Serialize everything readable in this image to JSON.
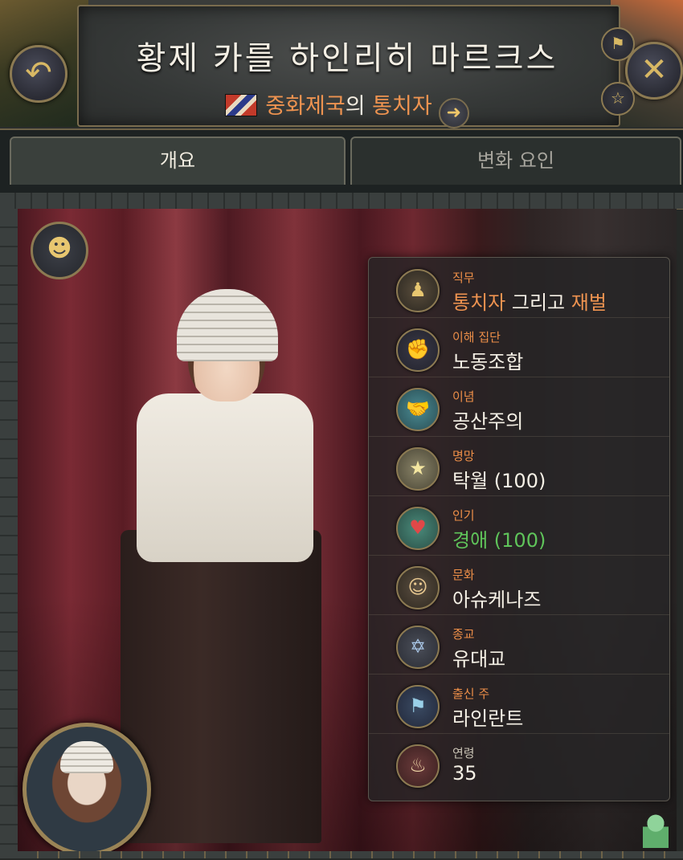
{
  "header": {
    "title": "황제 카를 하인리히 마르크스",
    "country_name": "중화제국",
    "connector": "의",
    "role": "통치자"
  },
  "tabs": [
    {
      "label": "개요",
      "active": true
    },
    {
      "label": "변화 요인",
      "active": false
    }
  ],
  "info": {
    "job": {
      "label": "직무",
      "value_part1": "통치자",
      "value_part2": " 그리고 ",
      "value_part3": "재벌",
      "icon": "figurehead-icon"
    },
    "interest_group": {
      "label": "이해 집단",
      "value": "노동조합",
      "icon": "wrench-fist-icon"
    },
    "ideology": {
      "label": "이념",
      "value": "공산주의",
      "icon": "handshake-icon"
    },
    "prestige": {
      "label": "명망",
      "value": "탁월 (100)",
      "icon": "star-person-icon"
    },
    "popularity": {
      "label": "인기",
      "value": "경애 (100)",
      "icon": "heart-thumbs-up-icon"
    },
    "culture": {
      "label": "문화",
      "value": "아슈케나즈",
      "icon": "masks-icon"
    },
    "religion": {
      "label": "종교",
      "value": "유대교",
      "icon": "star-of-david-icon"
    },
    "birth_state": {
      "label": "출신 주",
      "value": "라인란트",
      "icon": "flag-globe-icon"
    },
    "age": {
      "label": "연령",
      "value": "35",
      "icon": "cake-icon"
    }
  },
  "colors": {
    "accent_orange": "#ee9350",
    "positive_green": "#5fc45a",
    "gold_border": "#8c7a52"
  }
}
